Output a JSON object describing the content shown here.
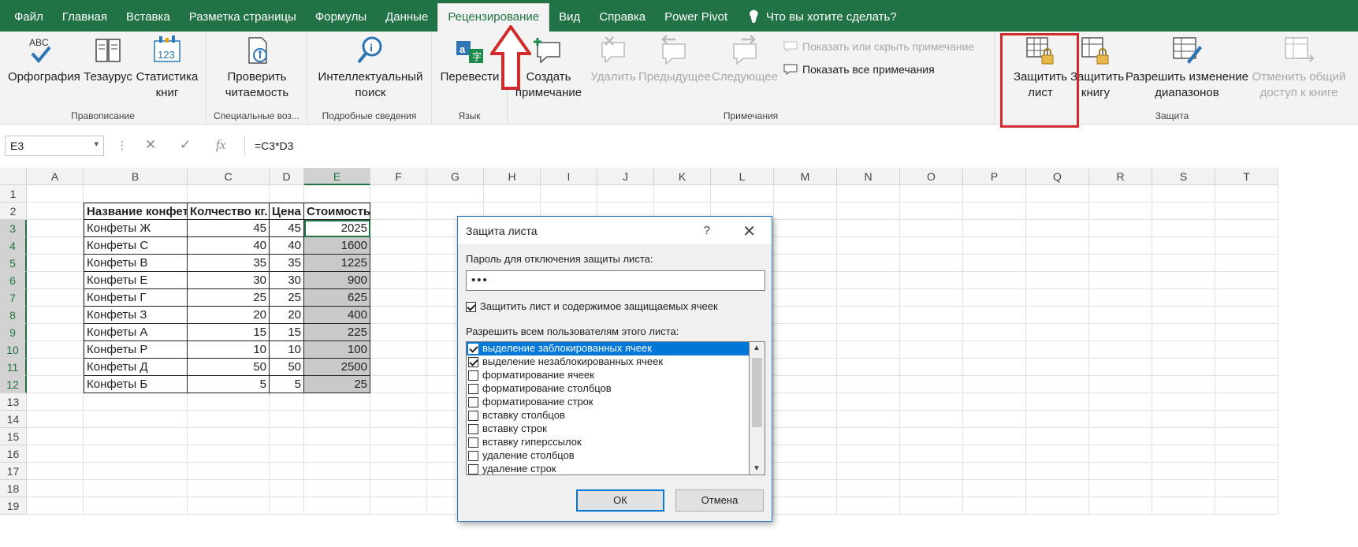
{
  "tabs": [
    "Файл",
    "Главная",
    "Вставка",
    "Разметка страницы",
    "Формулы",
    "Данные",
    "Рецензирование",
    "Вид",
    "Справка",
    "Power Pivot",
    "Что вы хотите сделать?"
  ],
  "active_tab": "Рецензирование",
  "ribbon": {
    "groups": {
      "spelling": "Правописание",
      "accessibility": "Специальные воз...",
      "insights": "Подробные сведения",
      "language": "Язык",
      "comments": "Примечания",
      "protect": "Защита"
    },
    "buttons": {
      "spelling": "Орфография",
      "thesaurus": "Тезаурус",
      "stats": "Статистика\nкниг",
      "check_access": "Проверить\nчитаемость",
      "smart_lookup": "Интеллектуальный\nпоиск",
      "translate": "Перевести",
      "new_comment": "Создать\nпримечание",
      "delete": "Удалить",
      "prev": "Предыдущее",
      "next": "Следующее",
      "show_hide": "Показать или скрыть примечание",
      "show_all": "Показать все примечания",
      "protect_sheet": "Защитить\nлист",
      "protect_book": "Защитить\nкнигу",
      "allow_edit": "Разрешить изменение\nдиапазонов",
      "unshare": "Отменить общий\nдоступ к книге"
    }
  },
  "formula_bar": {
    "name_box": "E3",
    "formula": "=C3*D3"
  },
  "grid": {
    "columns": [
      "A",
      "B",
      "C",
      "D",
      "E",
      "F",
      "G",
      "H",
      "I",
      "J",
      "K",
      "L",
      "M",
      "N",
      "O",
      "P",
      "Q",
      "R",
      "S",
      "T"
    ],
    "rows": [
      "1",
      "2",
      "3",
      "4",
      "5",
      "6",
      "7",
      "8",
      "9",
      "10",
      "11",
      "12",
      "13",
      "14",
      "15",
      "16",
      "17",
      "18",
      "19"
    ],
    "headers": [
      "Название конфет",
      "Колчество кг.",
      "Цена",
      "Стоимость"
    ],
    "data": [
      [
        "Конфеты Ж",
        "45",
        "45",
        "2025"
      ],
      [
        "Конфеты С",
        "40",
        "40",
        "1600"
      ],
      [
        "Конфеты В",
        "35",
        "35",
        "1225"
      ],
      [
        "Конфеты Е",
        "30",
        "30",
        "900"
      ],
      [
        "Конфеты Г",
        "25",
        "25",
        "625"
      ],
      [
        "Конфеты З",
        "20",
        "20",
        "400"
      ],
      [
        "Конфеты А",
        "15",
        "15",
        "225"
      ],
      [
        "Конфеты Р",
        "10",
        "10",
        "100"
      ],
      [
        "Конфеты Д",
        "50",
        "50",
        "2500"
      ],
      [
        "Конфеты Б",
        "5",
        "5",
        "25"
      ]
    ]
  },
  "dialog": {
    "title": "Защита листа",
    "help": "?",
    "close": "✕",
    "password_label": "Пароль для отключения защиты листа:",
    "password_value": "•••",
    "protect_check": "Защитить лист и содержимое защищаемых ячеек",
    "allow_label": "Разрешить всем пользователям этого листа:",
    "permissions": [
      {
        "label": "выделение заблокированных ячеек",
        "checked": true
      },
      {
        "label": "выделение незаблокированных ячеек",
        "checked": true
      },
      {
        "label": "форматирование ячеек",
        "checked": false
      },
      {
        "label": "форматирование столбцов",
        "checked": false
      },
      {
        "label": "форматирование строк",
        "checked": false
      },
      {
        "label": "вставку столбцов",
        "checked": false
      },
      {
        "label": "вставку строк",
        "checked": false
      },
      {
        "label": "вставку гиперссылок",
        "checked": false
      },
      {
        "label": "удаление столбцов",
        "checked": false
      },
      {
        "label": "удаление строк",
        "checked": false
      }
    ],
    "ok": "ОК",
    "cancel": "Отмена"
  },
  "colors": {
    "excel_green": "#217346",
    "highlight_red": "#d22b2b",
    "select_blue": "#0078d7"
  }
}
